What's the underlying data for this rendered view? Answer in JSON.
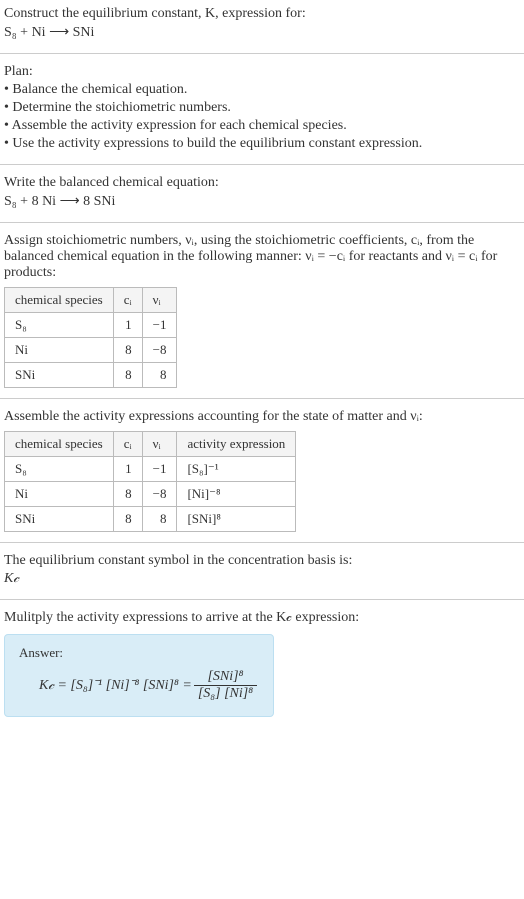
{
  "intro": {
    "title": "Construct the equilibrium constant, K, expression for:",
    "equation": "S₈ + Ni ⟶ SNi"
  },
  "plan": {
    "heading": "Plan:",
    "items": [
      "• Balance the chemical equation.",
      "• Determine the stoichiometric numbers.",
      "• Assemble the activity expression for each chemical species.",
      "• Use the activity expressions to build the equilibrium constant expression."
    ]
  },
  "balanced": {
    "heading": "Write the balanced chemical equation:",
    "equation": "S₈ + 8 Ni ⟶ 8 SNi"
  },
  "stoich": {
    "text1": "Assign stoichiometric numbers, νᵢ, using the stoichiometric coefficients, cᵢ, from the balanced chemical equation in the following manner: νᵢ = −cᵢ for reactants and νᵢ = cᵢ for products:",
    "headers": [
      "chemical species",
      "cᵢ",
      "νᵢ"
    ],
    "rows": [
      {
        "species": "S₈",
        "c": "1",
        "v": "−1"
      },
      {
        "species": "Ni",
        "c": "8",
        "v": "−8"
      },
      {
        "species": "SNi",
        "c": "8",
        "v": "8"
      }
    ]
  },
  "activity": {
    "text": "Assemble the activity expressions accounting for the state of matter and νᵢ:",
    "headers": [
      "chemical species",
      "cᵢ",
      "νᵢ",
      "activity expression"
    ],
    "rows": [
      {
        "species": "S₈",
        "c": "1",
        "v": "−1",
        "act": "[S₈]⁻¹"
      },
      {
        "species": "Ni",
        "c": "8",
        "v": "−8",
        "act": "[Ni]⁻⁸"
      },
      {
        "species": "SNi",
        "c": "8",
        "v": "8",
        "act": "[SNi]⁸"
      }
    ]
  },
  "symbol": {
    "text": "The equilibrium constant symbol in the concentration basis is:",
    "sym": "K𝒸"
  },
  "final": {
    "text": "Mulitply the activity expressions to arrive at the K𝒸 expression:",
    "answer_label": "Answer:",
    "lhs": "K𝒸 = [S₈]⁻¹ [Ni]⁻⁸ [SNi]⁸ =",
    "frac_num": "[SNi]⁸",
    "frac_den": "[S₈] [Ni]⁸"
  },
  "chart_data": {
    "type": "table",
    "title": "Stoichiometric numbers and activity expressions",
    "tables": [
      {
        "columns": [
          "chemical species",
          "c_i",
          "ν_i"
        ],
        "rows": [
          [
            "S₈",
            1,
            -1
          ],
          [
            "Ni",
            8,
            -8
          ],
          [
            "SNi",
            8,
            8
          ]
        ]
      },
      {
        "columns": [
          "chemical species",
          "c_i",
          "ν_i",
          "activity expression"
        ],
        "rows": [
          [
            "S₈",
            1,
            -1,
            "[S₈]^-1"
          ],
          [
            "Ni",
            8,
            -8,
            "[Ni]^-8"
          ],
          [
            "SNi",
            8,
            8,
            "[SNi]^8"
          ]
        ]
      }
    ],
    "balanced_equation": "S₈ + 8 Ni → 8 SNi",
    "K_c": "[SNi]^8 / ([S₈] [Ni]^8)"
  }
}
